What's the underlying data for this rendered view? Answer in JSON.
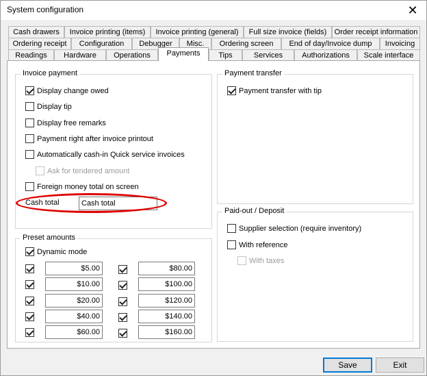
{
  "window": {
    "title": "System configuration"
  },
  "tabs": {
    "row1": [
      "Cash drawers",
      "Invoice printing (items)",
      "Invoice printing (general)",
      "Full size invoice (fields)",
      "Order receipt information"
    ],
    "row2": [
      "Ordering receipt",
      "Configuration",
      "Debugger",
      "Misc.",
      "Ordering screen",
      "End of day/Invoice dump",
      "Invoicing"
    ],
    "row3": [
      "Readings",
      "Hardware",
      "Operations",
      "Payments",
      "Tips",
      "Services",
      "Authorizations",
      "Scale interface"
    ],
    "active": "Payments"
  },
  "invoice_payment": {
    "title": "Invoice payment",
    "display_change_owed": "Display change owed",
    "display_tip": "Display tip",
    "display_free_remarks": "Display free remarks",
    "payment_right_after": "Payment right after invoice printout",
    "auto_cash_in": "Automatically cash-in Quick service invoices",
    "ask_tendered": "Ask for tendered amount",
    "foreign_money": "Foreign money total on screen",
    "cash_total_label": "Cash total",
    "cash_total_value": "Cash total"
  },
  "payment_transfer": {
    "title": "Payment transfer",
    "with_tip": "Payment transfer with tip"
  },
  "preset_amounts": {
    "title": "Preset amounts",
    "dynamic_mode": "Dynamic mode",
    "left": [
      "$5.00",
      "$10.00",
      "$20.00",
      "$40.00",
      "$60.00"
    ],
    "right": [
      "$80.00",
      "$100.00",
      "$120.00",
      "$140.00",
      "$160.00"
    ]
  },
  "paid_out": {
    "title": "Paid-out / Deposit",
    "supplier_selection": "Supplier selection (require inventory)",
    "with_reference": "With reference",
    "with_taxes": "With taxes"
  },
  "buttons": {
    "save": "Save",
    "exit": "Exit"
  },
  "colors": {
    "highlight": "#e00000",
    "default_button_border": "#0078d7"
  }
}
